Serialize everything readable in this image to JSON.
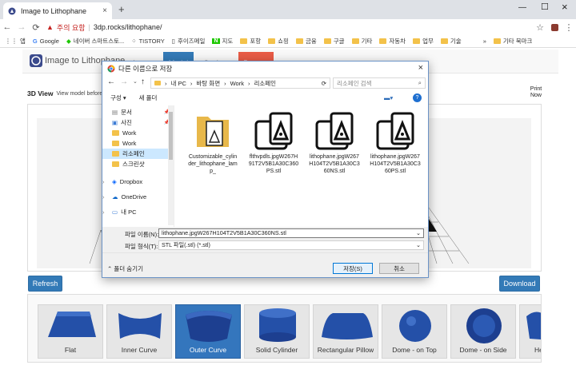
{
  "browser": {
    "tab_title": "Image to Lithophane",
    "not_secure": "주의 요함",
    "url": "3dp.rocks/lithophane/",
    "bookmarks": [
      "앱",
      "Google",
      "네이버 스마트스토...",
      "TISTORY",
      "후이즈메일",
      "지도",
      "포항",
      "쇼핑",
      "금융",
      "구글",
      "기타",
      "자동차",
      "업무",
      "기술"
    ],
    "other_bookmarks": "기타 북마크"
  },
  "page": {
    "brand": "Image to Lithophane",
    "nav": {
      "images": "Images",
      "model": "Model",
      "settings": "Settings",
      "patreon": "Patreon"
    },
    "section_title": "3D View",
    "section_subtitle": "View model before",
    "print_now": "Print Now",
    "refresh": "Refresh",
    "download": "Download",
    "shapes": [
      {
        "label": "Flat"
      },
      {
        "label": "Inner Curve"
      },
      {
        "label": "Outer Curve"
      },
      {
        "label": "Solid Cylinder"
      },
      {
        "label": "Rectangular Pillow"
      },
      {
        "label": "Dome - on Top"
      },
      {
        "label": "Dome - on Side"
      },
      {
        "label": "Hea"
      }
    ],
    "selected_shape": "Outer Curve"
  },
  "dialog": {
    "title": "다른 이름으로 저장",
    "path": [
      "내 PC",
      "바탕 화면",
      "Work",
      "리소페인"
    ],
    "search_placeholder": "리소페인 검색",
    "organize": "구성",
    "new_folder": "새 폴더",
    "nav_items": [
      {
        "label": "문서",
        "icon": "document-icon"
      },
      {
        "label": "사진",
        "icon": "picture-icon"
      },
      {
        "label": "Work",
        "icon": "folder-icon"
      },
      {
        "label": "Work",
        "icon": "folder-icon"
      },
      {
        "label": "리소페인",
        "icon": "folder-icon"
      },
      {
        "label": "스크린샷",
        "icon": "folder-icon"
      },
      {
        "label": "Dropbox",
        "icon": "dropbox-icon"
      },
      {
        "label": "OneDrive",
        "icon": "onedrive-icon"
      },
      {
        "label": "내 PC",
        "icon": "pc-icon"
      }
    ],
    "files": [
      {
        "name": "Customizable_cylinder_lithophane_lamp_",
        "type": "folder"
      },
      {
        "name": "flthvpdls.jpgW267H91T2V5B1A30C360PS.stl",
        "type": "stl"
      },
      {
        "name": "lithophane.jpgW267H104T2V5B1A30C360NS.stl",
        "type": "stl"
      },
      {
        "name": "lithophane.jpgW267H104T2V5B1A30C360PS.stl",
        "type": "stl"
      }
    ],
    "filename_label": "파일 이름(N):",
    "filename_value": "lithophane.jpgW267H104T2V5B1A30C360NS.stl",
    "filetype_label": "파일 형식(T):",
    "filetype_value": "STL 파일(.stl) (*.stl)",
    "hide_folders": "폴더 숨기기",
    "save": "저장(S)",
    "cancel": "취소"
  }
}
